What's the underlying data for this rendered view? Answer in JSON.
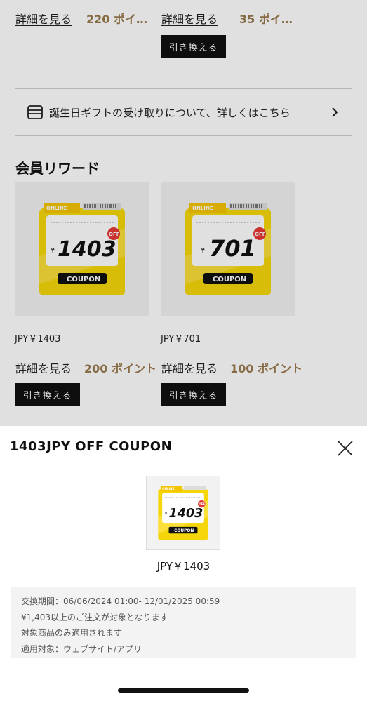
{
  "top_row": {
    "left_detail": "詳細を見る",
    "left_points": "220 ポイ…",
    "right_detail": "詳細を見る",
    "right_points": "35 ポイ…",
    "exchange": "引き換える"
  },
  "gift_banner": {
    "icon": "gift-card-icon",
    "text": "誕生日ギフトの受け取りについて、詳しくはこちら",
    "chevron": "chevron-right-icon"
  },
  "section_title": "会員リワード",
  "rewards": [
    {
      "image_label": "1403",
      "image_currency": "¥",
      "image_badge": "OFF",
      "image_tag": "COUPON",
      "image_brand": "ONLINE",
      "price": "JPY￥1403",
      "detail": "詳細を見る",
      "points": "200 ポイント",
      "exchange": "引き換える"
    },
    {
      "image_label": "701",
      "image_currency": "¥",
      "image_badge": "OFF",
      "image_tag": "COUPON",
      "image_brand": "ONLINE",
      "price": "JPY￥701",
      "detail": "詳細を見る",
      "points": "100 ポイント",
      "exchange": "引き換える"
    }
  ],
  "sheet": {
    "title": "1403JPY OFF COUPON",
    "close_icon": "close-icon",
    "image_label": "1403",
    "image_currency": "¥",
    "image_badge": "OFF",
    "image_tag": "COUPON",
    "image_brand": "ONLINE",
    "price": "JPY￥1403",
    "info": [
      "交換期間：06/06/2024 01:00- 12/01/2025 00:59",
      "¥1,403以上のご注文が対象となります",
      "対象商品のみ適用されます",
      "適用対象：ウェブサイト/アプリ"
    ]
  },
  "colors": {
    "accent_gold": "#9a7a4e",
    "coupon_yellow": "#f5d60a",
    "button_black": "#111111",
    "badge_red": "#e53935"
  }
}
